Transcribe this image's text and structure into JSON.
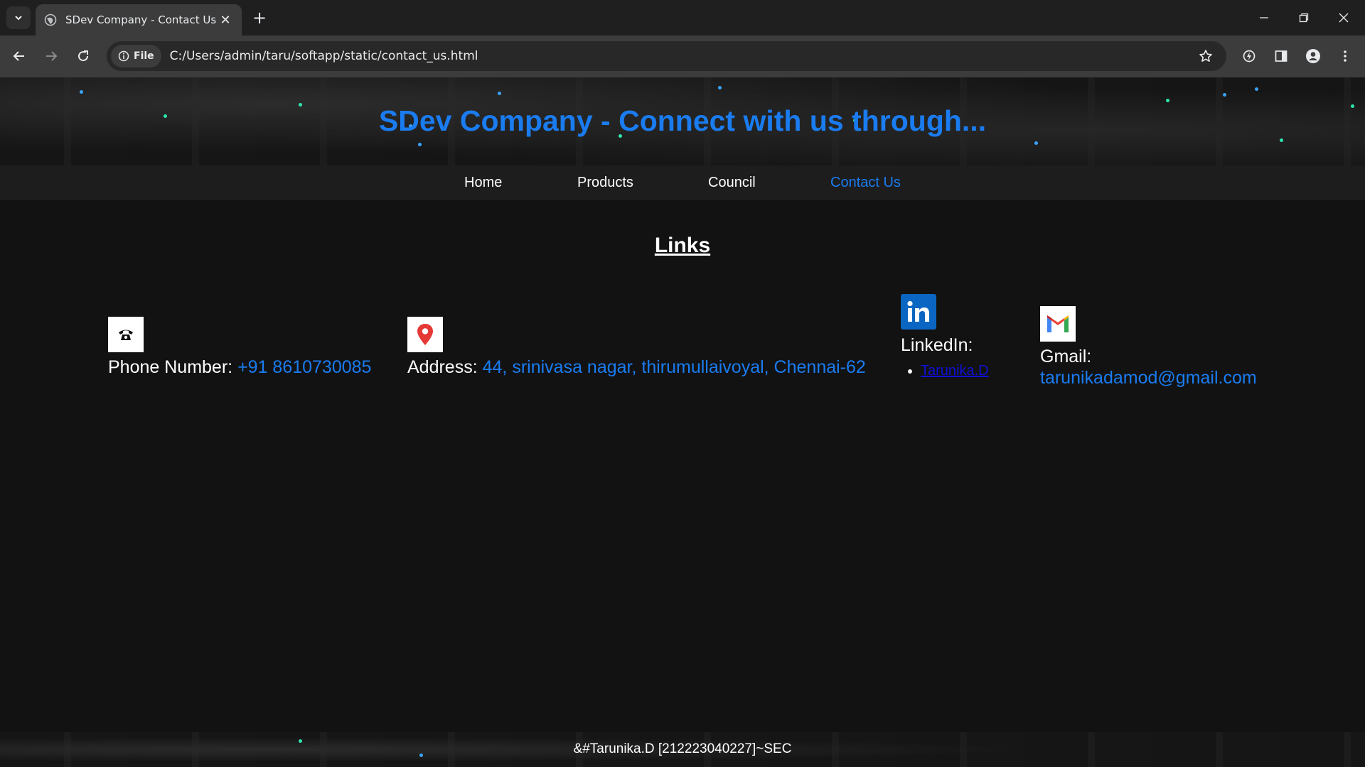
{
  "browser": {
    "tab_title": "SDev Company - Contact Us",
    "url_chip": "File",
    "url": "C:/Users/admin/taru/softapp/static/contact_us.html"
  },
  "page": {
    "title": "SDev Company - Connect with us through...",
    "nav": [
      {
        "label": "Home",
        "active": false
      },
      {
        "label": "Products",
        "active": false
      },
      {
        "label": "Council",
        "active": false
      },
      {
        "label": "Contact Us",
        "active": true
      }
    ],
    "links_heading": "Links",
    "contacts": {
      "phone": {
        "label": "Phone Number:",
        "value": "+91 8610730085",
        "icon": "telephone-icon"
      },
      "address": {
        "label": "Address:",
        "value": "44, srinivasa nagar, thirumullaivoyal, Chennai-62",
        "icon": "location-pin-icon"
      },
      "linkedin": {
        "label": "LinkedIn:",
        "link_text": "Tarunika.D",
        "icon": "linkedin-icon"
      },
      "gmail": {
        "label": "Gmail:",
        "value": "tarunikadamod@gmail.com",
        "icon": "gmail-icon"
      }
    },
    "footer": "&#Tarunika.D [212223040227]~SEC"
  },
  "colors": {
    "accent": "#1a7cf0",
    "link": "#1010d8",
    "background": "#121212",
    "navbar": "#1d1d1d"
  }
}
